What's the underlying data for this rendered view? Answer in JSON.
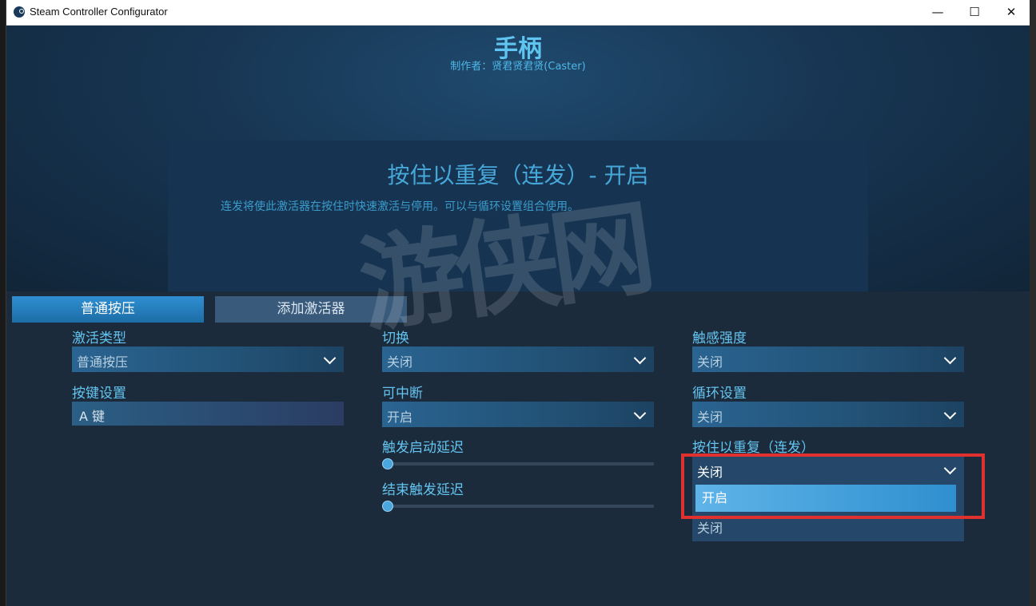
{
  "window": {
    "title": "Steam Controller Configurator",
    "min": "—",
    "max": "☐",
    "close": "✕"
  },
  "header": {
    "title": "手柄",
    "author": "制作者：贤君贤君贤(Caster)"
  },
  "info": {
    "title": "按住以重复（连发）- 开启",
    "description": "连发将使此激活器在按住时快速激活与停用。可以与循环设置组合使用。"
  },
  "tabs": [
    {
      "label": "普通按压"
    },
    {
      "label": "添加激活器"
    }
  ],
  "left": {
    "activation_type_label": "激活类型",
    "activation_type_value": "普通按压",
    "key_settings_label": "按键设置",
    "key_value": "A 键"
  },
  "middle": {
    "toggle_label": "切换",
    "toggle_value": "关闭",
    "interruptible_label": "可中断",
    "interruptible_value": "开启",
    "start_delay_label": "触发启动延迟",
    "start_delay": 0,
    "end_delay_label": "结束触发延迟",
    "end_delay": 0
  },
  "right": {
    "haptic_label": "触感强度",
    "haptic_value": "关闭",
    "cycle_label": "循环设置",
    "cycle_value": "关闭",
    "repeat_label": "按住以重复（连发）",
    "repeat_value": "关闭",
    "repeat_options": [
      "开启",
      "关闭"
    ]
  },
  "watermark": "游侠网",
  "colors": {
    "accent": "#5fc4ef",
    "highlight": "#e0312f"
  }
}
